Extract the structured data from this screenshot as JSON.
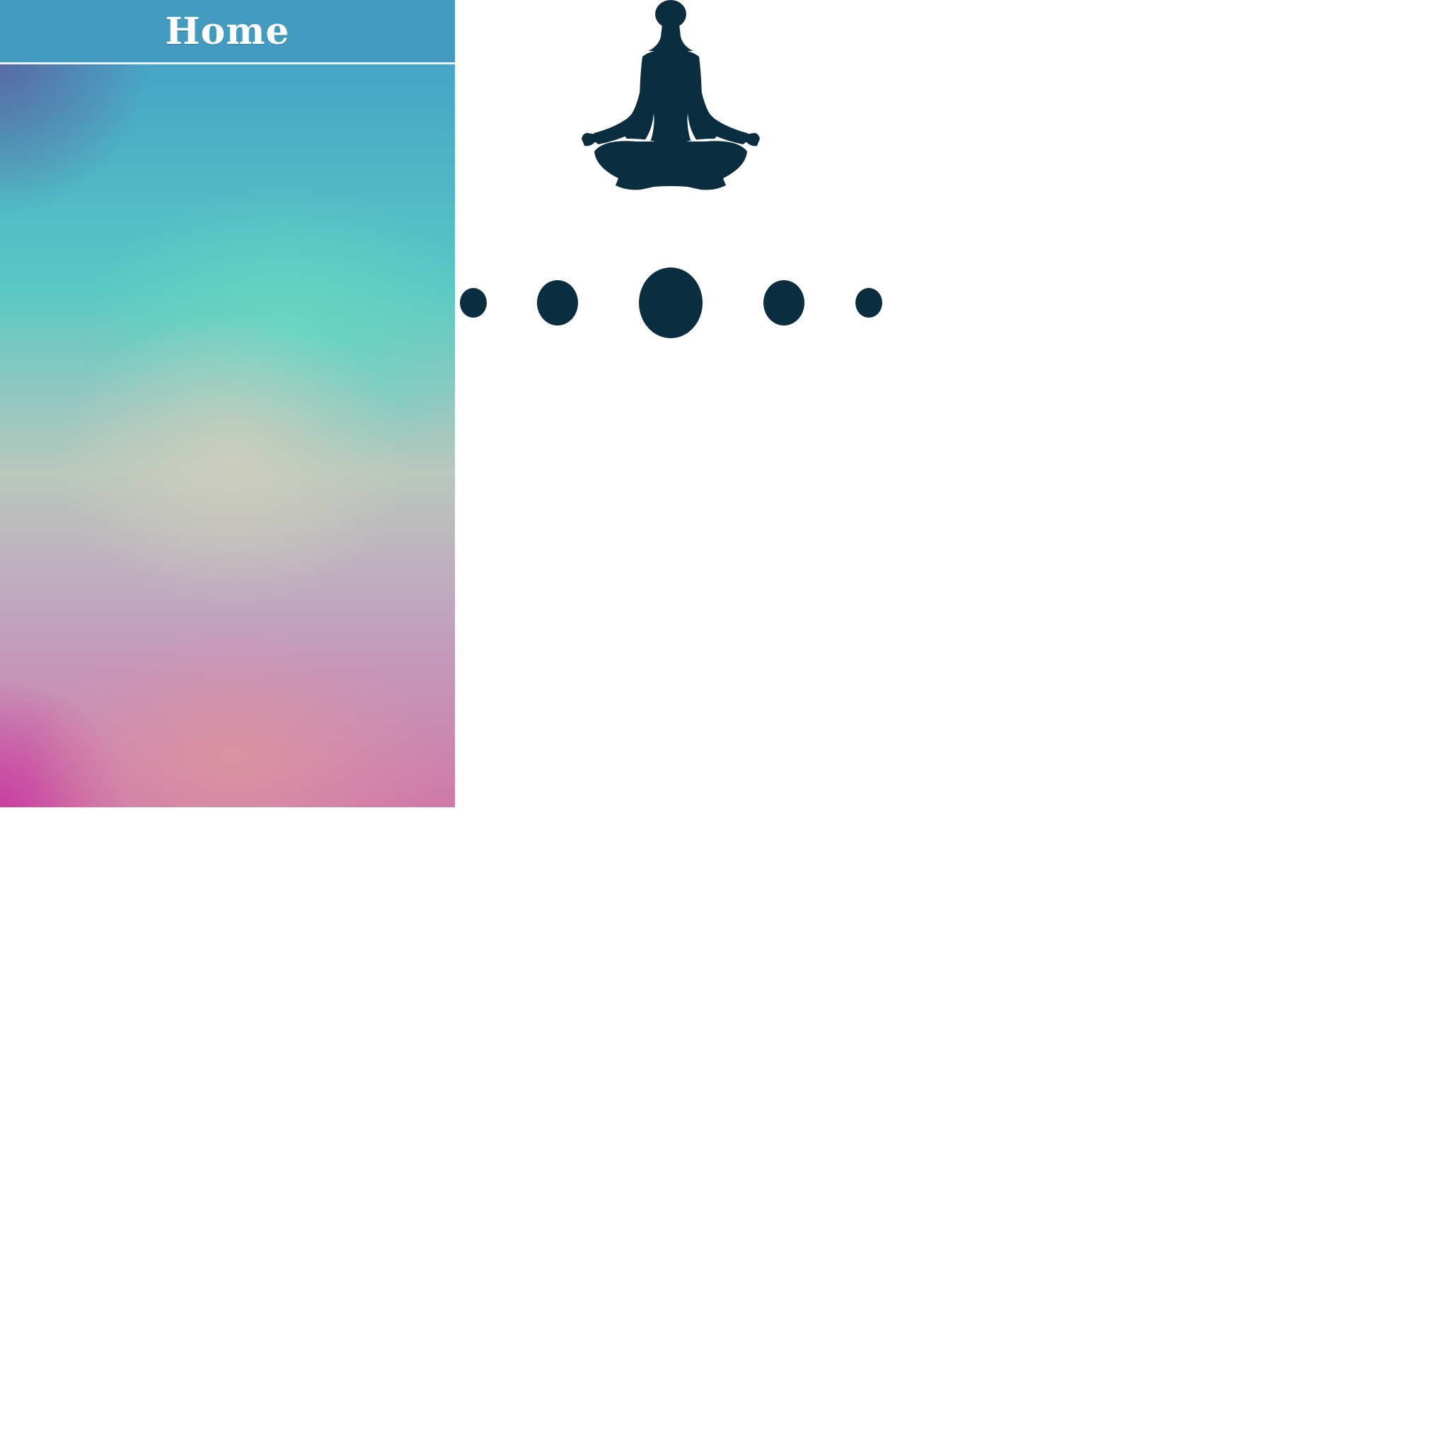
{
  "header": {
    "title": "Home"
  },
  "colors": {
    "header_bg": "#449bc0",
    "figure": "#0a2e40",
    "page_bg": "#ffffff"
  },
  "icons": {
    "figure": "meditation-figure-icon",
    "dots": "loading-dots-icon"
  }
}
